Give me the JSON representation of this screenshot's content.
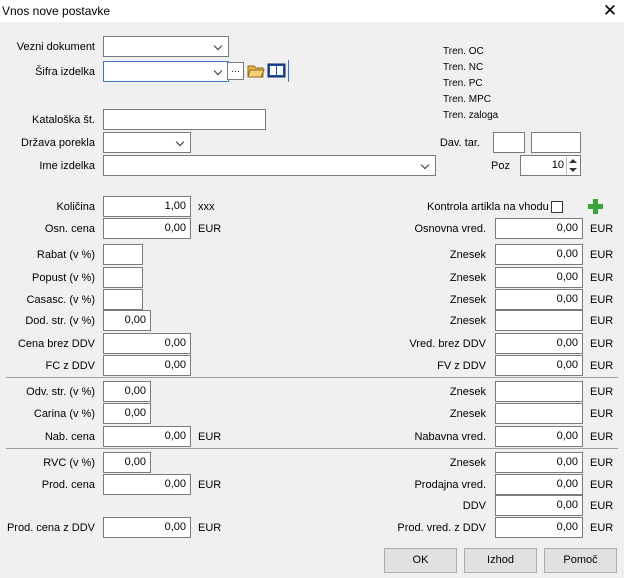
{
  "window": {
    "title": "Vnos nove postavke",
    "close_glyph": "✕"
  },
  "header": {
    "vezni_dokument_label": "Vezni dokument",
    "vezni_dokument_value": "",
    "sifra_izdelka_label": "Šifra izdelka",
    "sifra_izdelka_value": "",
    "browse_glyph": "···",
    "kataloska_label": "Kataloška št.",
    "kataloska_value": "",
    "drzava_label": "Država porekla",
    "drzava_value": "",
    "ime_label": "Ime izdelka",
    "ime_value": "",
    "tren_oc": "Tren. OC",
    "tren_nc": "Tren. NC",
    "tren_pc": "Tren. PC",
    "tren_mpc": "Tren. MPC",
    "tren_zaloga": "Tren. zaloga",
    "dav_tar_label": "Dav. tar.",
    "dav_tar_value1": "",
    "dav_tar_value2": "",
    "poz_label": "Poz",
    "poz_value": "10"
  },
  "left": {
    "kolicina_label": "Količina",
    "kolicina_value": "1,00",
    "kolicina_unit": "xxx",
    "osn_cena_label": "Osn. cena",
    "osn_cena_value": "0,00",
    "osn_cena_unit": "EUR",
    "rabat_label": "Rabat (v %)",
    "rabat_value": "",
    "popust_label": "Popust (v %)",
    "popust_value": "",
    "casasc_label": "Casasc. (v %)",
    "casasc_value": "",
    "dod_str_label": "Dod. str. (v %)",
    "dod_str_value": "0,00",
    "cena_brez_ddv_label": "Cena brez DDV",
    "cena_brez_ddv_value": "0,00",
    "fc_z_ddv_label": "FC z DDV",
    "fc_z_ddv_value": "0,00",
    "odv_str_label": "Odv. str. (v %)",
    "odv_str_value": "0,00",
    "carina_label": "Carina (v %)",
    "carina_value": "0,00",
    "nab_cena_label": "Nab. cena",
    "nab_cena_value": "0,00",
    "nab_cena_unit": "EUR",
    "rvc_label": "RVC (v %)",
    "rvc_value": "0,00",
    "prod_cena_label": "Prod. cena",
    "prod_cena_value": "0,00",
    "prod_cena_unit": "EUR",
    "prod_cena_ddv_label": "Prod. cena z DDV",
    "prod_cena_ddv_value": "0,00",
    "prod_cena_ddv_unit": "EUR"
  },
  "right": {
    "kontrola_label": "Kontrola artikla na vhodu",
    "osnovna_vred_label": "Osnovna vred.",
    "osnovna_vred_value": "0,00",
    "znesek_label": "Znesek",
    "znesek_rabat_value": "0,00",
    "znesek_popust_value": "0,00",
    "znesek_casasc_value": "0,00",
    "znesek_dod_value": "",
    "vred_brez_ddv_label": "Vred. brez DDV",
    "vred_brez_ddv_value": "0,00",
    "fv_z_ddv_label": "FV z DDV",
    "fv_z_ddv_value": "0,00",
    "znesek_odv_value": "",
    "znesek_carina_value": "",
    "nabavna_vred_label": "Nabavna vred.",
    "nabavna_vred_value": "0,00",
    "znesek_rvc_value": "0,00",
    "prodajna_vred_label": "Prodajna vred.",
    "prodajna_vred_value": "0,00",
    "ddv_label": "DDV",
    "ddv_value": "0,00",
    "prod_vred_ddv_label": "Prod. vred. z DDV",
    "prod_vred_ddv_value": "0,00",
    "unit": "EUR"
  },
  "buttons": {
    "ok": "OK",
    "izhod": "Izhod",
    "pomoc": "Pomoč"
  }
}
